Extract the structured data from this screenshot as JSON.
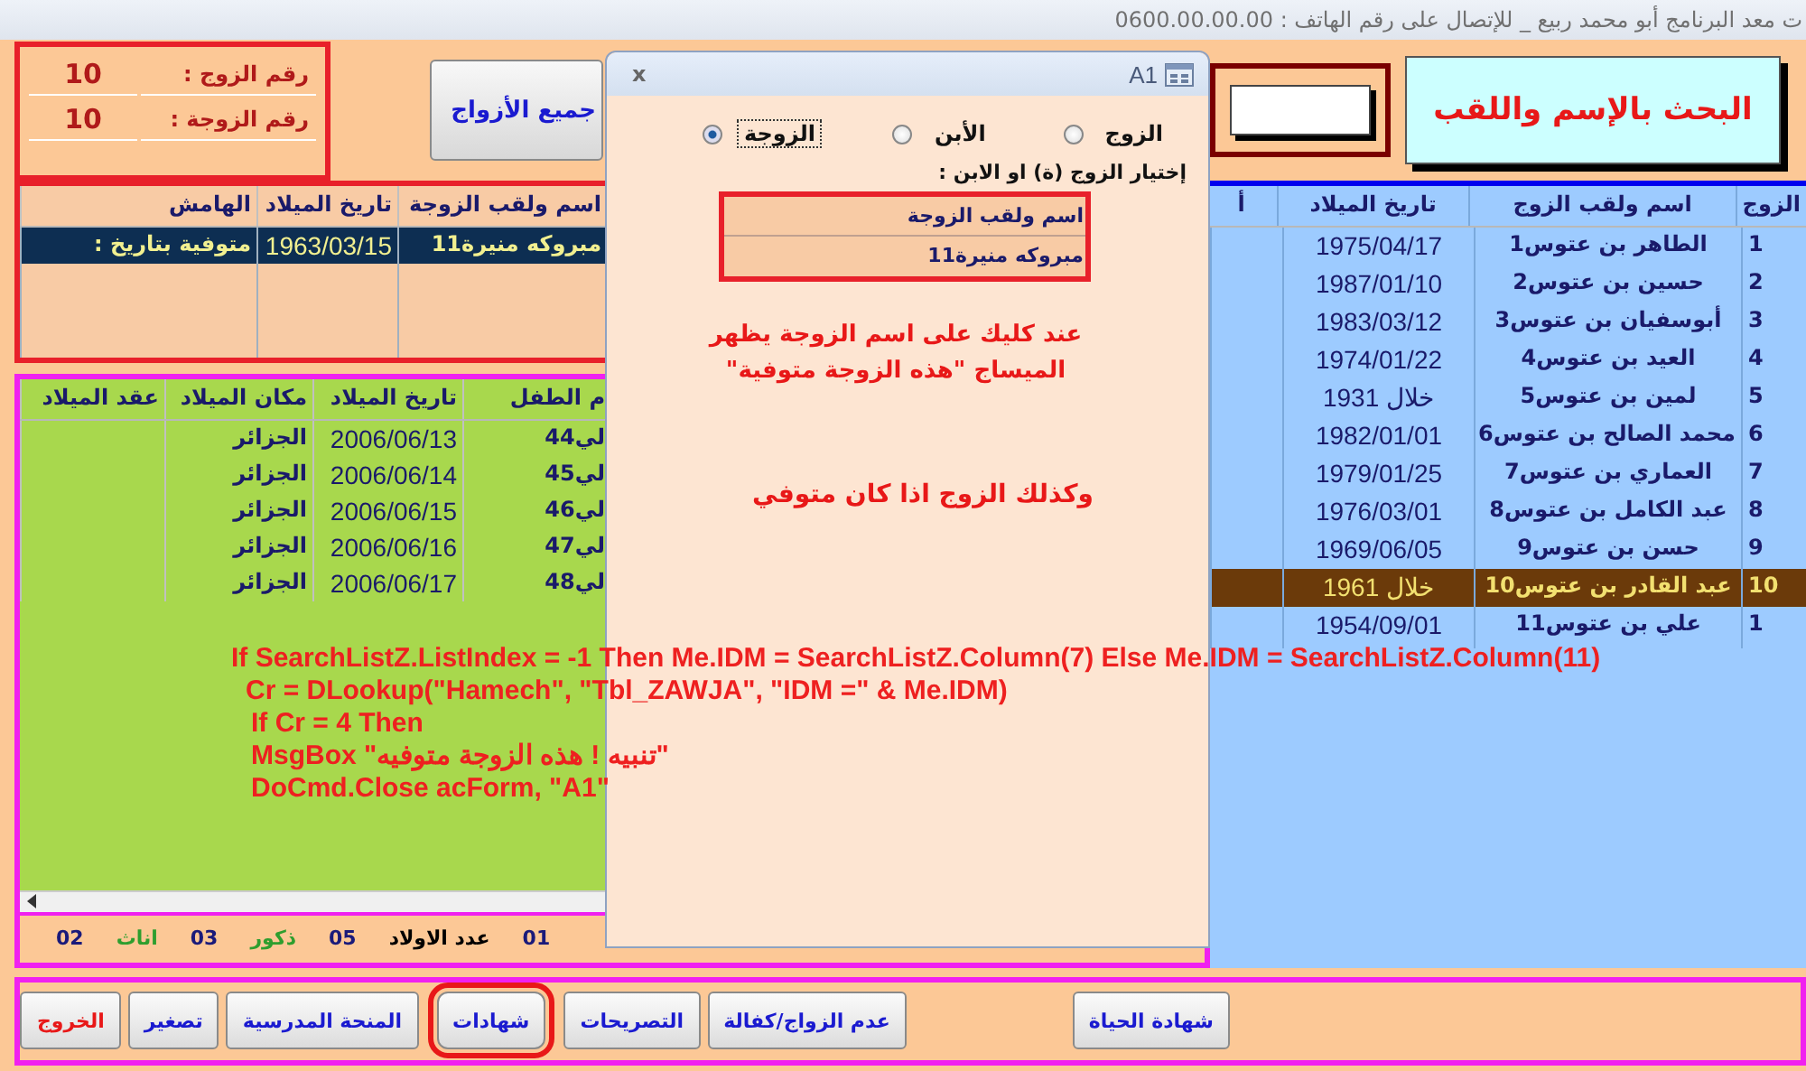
{
  "window": {
    "title": "ت معد البرنامج أبو محمد ربيع _ للإتصال على رقم الهاتف : 0600.00.00.00"
  },
  "numbers": [
    {
      "label": "رقم الزوج :",
      "value": "10"
    },
    {
      "label": "رقم الزوجة :",
      "value": "10"
    }
  ],
  "all_husbands_button": "جميع الأزواج",
  "search_button": "البحث بالإسم واللقب",
  "wives_list": {
    "columns": [
      "اسم ولقب الزوجة",
      "تاريخ الميلاد",
      "الهامش"
    ],
    "rows": [
      {
        "note": "متوفية بتاريخ :",
        "birth_date": "1963/03/15",
        "name": "مبروكه منيرة11",
        "selected": true
      }
    ]
  },
  "children_list": {
    "columns": [
      "م الطفل",
      "تاريخ الميلاد",
      "مكان الميلاد",
      "عقد الميلاد"
    ],
    "rows": [
      {
        "birth_place": "الجزائر",
        "birth_date": "2006/06/13",
        "name": "لي44"
      },
      {
        "birth_place": "الجزائر",
        "birth_date": "2006/06/14",
        "name": "لي45"
      },
      {
        "birth_place": "الجزائر",
        "birth_date": "2006/06/15",
        "name": "لي46"
      },
      {
        "birth_place": "الجزائر",
        "birth_date": "2006/06/16",
        "name": "لي47"
      },
      {
        "birth_place": "الجزائر",
        "birth_date": "2006/06/17",
        "name": "لي48"
      }
    ]
  },
  "children_counts": [
    {
      "text": "01",
      "color": "#1a1a7a"
    },
    {
      "text": "عدد الاولاد",
      "color": "#000000"
    },
    {
      "text": "05",
      "color": "#1a1a7a"
    },
    {
      "text": "ذكور",
      "color": "#2e9e2e"
    },
    {
      "text": "03",
      "color": "#1a1a7a"
    },
    {
      "text": "اناث",
      "color": "#2e9e2e"
    },
    {
      "text": "02",
      "color": "#1a1a7a"
    }
  ],
  "husbands_list": {
    "columns": [
      "الزوج",
      "اسم ولقب الزوج",
      "تاريخ الميلاد",
      "أ"
    ],
    "rows": [
      {
        "birth_date": "1975/04/17",
        "name": "الطاهر بن عتوس1",
        "number": "1",
        "selected": false
      },
      {
        "birth_date": "1987/01/10",
        "name": "حسين بن عتوس2",
        "number": "2",
        "selected": false
      },
      {
        "birth_date": "1983/03/12",
        "name": "أبوسفيان بن عتوس3",
        "number": "3",
        "selected": false
      },
      {
        "birth_date": "1974/01/22",
        "name": "العيد بن عتوس4",
        "number": "4",
        "selected": false
      },
      {
        "birth_date": "خلال 1931",
        "name": "لمين بن عتوس5",
        "number": "5",
        "selected": false
      },
      {
        "birth_date": "1982/01/01",
        "name": "محمد الصالح بن عتوس6",
        "number": "6",
        "selected": false
      },
      {
        "birth_date": "1979/01/25",
        "name": "العماري بن عتوس7",
        "number": "7",
        "selected": false
      },
      {
        "birth_date": "1976/03/01",
        "name": "عبد الكامل بن عتوس8",
        "number": "8",
        "selected": false
      },
      {
        "birth_date": "1969/06/05",
        "name": "حسن بن عتوس9",
        "number": "9",
        "selected": false
      },
      {
        "birth_date": "خلال 1961",
        "name": "عبد القادر بن عتوس10",
        "number": "10",
        "selected": true
      },
      {
        "birth_date": "1954/09/01",
        "name": "علي بن عتوس11",
        "number": "1",
        "selected": false
      }
    ]
  },
  "bottom_buttons": [
    {
      "label": "شهادة الحياة",
      "kind": "normal",
      "circled": false
    },
    {
      "label": "عدم الزواج/كفالة",
      "kind": "normal",
      "circled": false
    },
    {
      "label": "التصريحات",
      "kind": "normal",
      "circled": false
    },
    {
      "label": "شهادات",
      "kind": "normal",
      "circled": true
    },
    {
      "label": "المنحة المدرسية",
      "kind": "normal",
      "circled": false
    },
    {
      "label": "تصغير",
      "kind": "normal",
      "circled": false
    },
    {
      "label": "الخروج",
      "kind": "exit",
      "circled": false
    }
  ],
  "dialog": {
    "title": "A1",
    "close": "x",
    "radios": [
      {
        "label": "الزوج",
        "selected": false
      },
      {
        "label": "الأبن",
        "selected": false
      },
      {
        "label": "الزوجة",
        "selected": true
      }
    ],
    "prompt": "إختيار الزوج (ة) او الابن :",
    "list": {
      "column": "اسم ولقب الزوجة",
      "rows": [
        "مبروكه منيرة11"
      ]
    },
    "notes": [
      "عند كليك على اسم الزوجة يظهر الميساج \"هذه الزوجة متوفية\"",
      "وكذلك الزوج اذا كان متوفي"
    ]
  },
  "code_annotation": [
    "If SearchListZ.ListIndex = -1 Then Me.IDM = SearchListZ.Column(7) Else Me.IDM = SearchListZ.Column(11)",
    "Cr = DLookup(\"Hamech\", \"Tbl_ZAWJA\", \"IDM =\" & Me.IDM)",
    "If Cr = 4 Then",
    "MsgBox \"تنبيه ! هذه الزوجة متوفيه\"",
    "DoCmd.Close acForm, \"A1\""
  ]
}
